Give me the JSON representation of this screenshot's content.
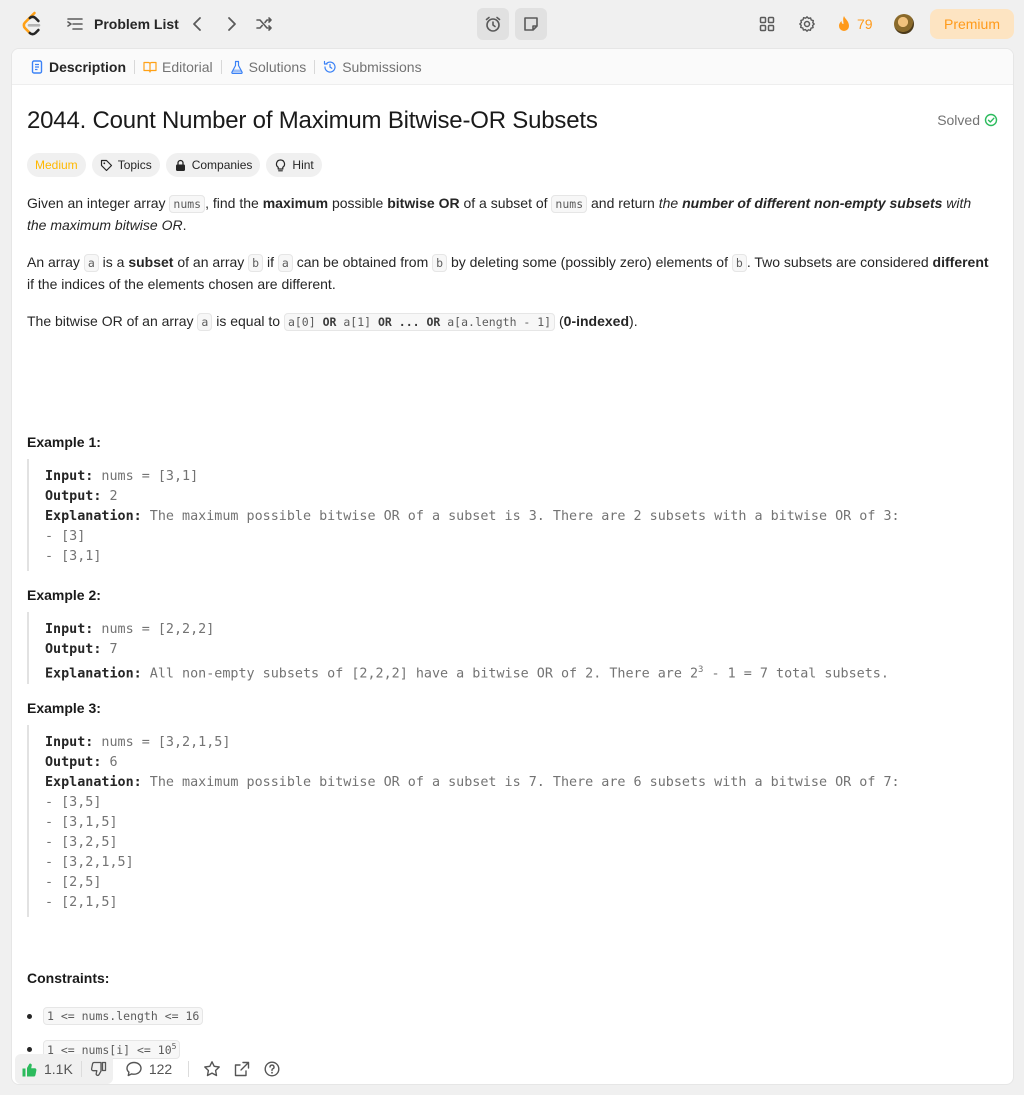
{
  "topbar": {
    "problem_list_label": "Problem List",
    "streak_count": "79",
    "premium_label": "Premium"
  },
  "tabs": [
    {
      "label": "Description",
      "icon": "document-icon",
      "color": "#3b82f6"
    },
    {
      "label": "Editorial",
      "icon": "book-icon",
      "color": "#ffa116"
    },
    {
      "label": "Solutions",
      "icon": "flask-icon",
      "color": "#3b82f6"
    },
    {
      "label": "Submissions",
      "icon": "history-icon",
      "color": "#3b82f6"
    }
  ],
  "problem": {
    "title": "2044. Count Number of Maximum Bitwise-OR Subsets",
    "status": "Solved",
    "difficulty": "Medium",
    "tags": [
      "Topics",
      "Companies",
      "Hint"
    ]
  },
  "description": {
    "p1": {
      "t1": "Given an integer array ",
      "c1": "nums",
      "t2": ", find the ",
      "b1": "maximum",
      "t3": " possible ",
      "b2": "bitwise OR",
      "t4": " of a subset of ",
      "c2": "nums",
      "t5": " and return ",
      "i1": "the ",
      "bi1": "number of different non-empty subsets",
      "i2": " with the maximum bitwise OR",
      "t6": "."
    },
    "p2": {
      "t1": "An array ",
      "c1": "a",
      "t2": " is a ",
      "b1": "subset",
      "t3": " of an array ",
      "c2": "b",
      "t4": " if ",
      "c3": "a",
      "t5": " can be obtained from ",
      "c4": "b",
      "t6": " by deleting some (possibly zero) elements of ",
      "c5": "b",
      "t7": ". Two subsets are considered ",
      "b2": "different",
      "t8": " if the indices of the elements chosen are different."
    },
    "p3": {
      "t1": "The bitwise OR of an array ",
      "c1": "a",
      "t2": " is equal to ",
      "c2a": "a[0] ",
      "c2b": "OR",
      "c2c": " a[1] ",
      "c2d": "OR",
      "c2e": " ... ",
      "c2f": "OR",
      "c2g": " a[a.length - 1]",
      "t3": " (",
      "b1": "0-indexed",
      "t4": ")."
    }
  },
  "examples": [
    {
      "heading": "Example 1:",
      "input_label": "Input:",
      "input": " nums = [3,1]",
      "output_label": "Output:",
      "output": " 2",
      "expl_label": "Explanation:",
      "expl": " The maximum possible bitwise OR of a subset is 3. There are 2 subsets with a bitwise OR of 3:",
      "lines": [
        "- [3]",
        "- [3,1]"
      ]
    },
    {
      "heading": "Example 2:",
      "input_label": "Input:",
      "input": " nums = [2,2,2]",
      "output_label": "Output:",
      "output": " 7",
      "expl_label": "Explanation:",
      "expl_a": " All non-empty subsets of [2,2,2] have a bitwise OR of 2. There are 2",
      "expl_sup": "3",
      "expl_b": " - 1 = 7 total subsets."
    },
    {
      "heading": "Example 3:",
      "input_label": "Input:",
      "input": " nums = [3,2,1,5]",
      "output_label": "Output:",
      "output": " 6",
      "expl_label": "Explanation:",
      "expl": " The maximum possible bitwise OR of a subset is 7. There are 6 subsets with a bitwise OR of 7:",
      "lines": [
        "- [3,5]",
        "- [3,1,5]",
        "- [3,2,5]",
        "- [3,2,1,5]",
        "- [2,5]",
        "- [2,1,5]"
      ]
    }
  ],
  "constraints": {
    "heading": "Constraints:",
    "c1": "1 <= nums.length <= 16",
    "c2a": "1 <= nums[i] <= 10",
    "c2sup": "5"
  },
  "footer": {
    "likes": "1.1K",
    "comments": "122"
  },
  "colors": {
    "accent": "#ffa116",
    "medium": "#ffb800",
    "solved": "#2cbb5d",
    "like": "#2cbb5d"
  }
}
